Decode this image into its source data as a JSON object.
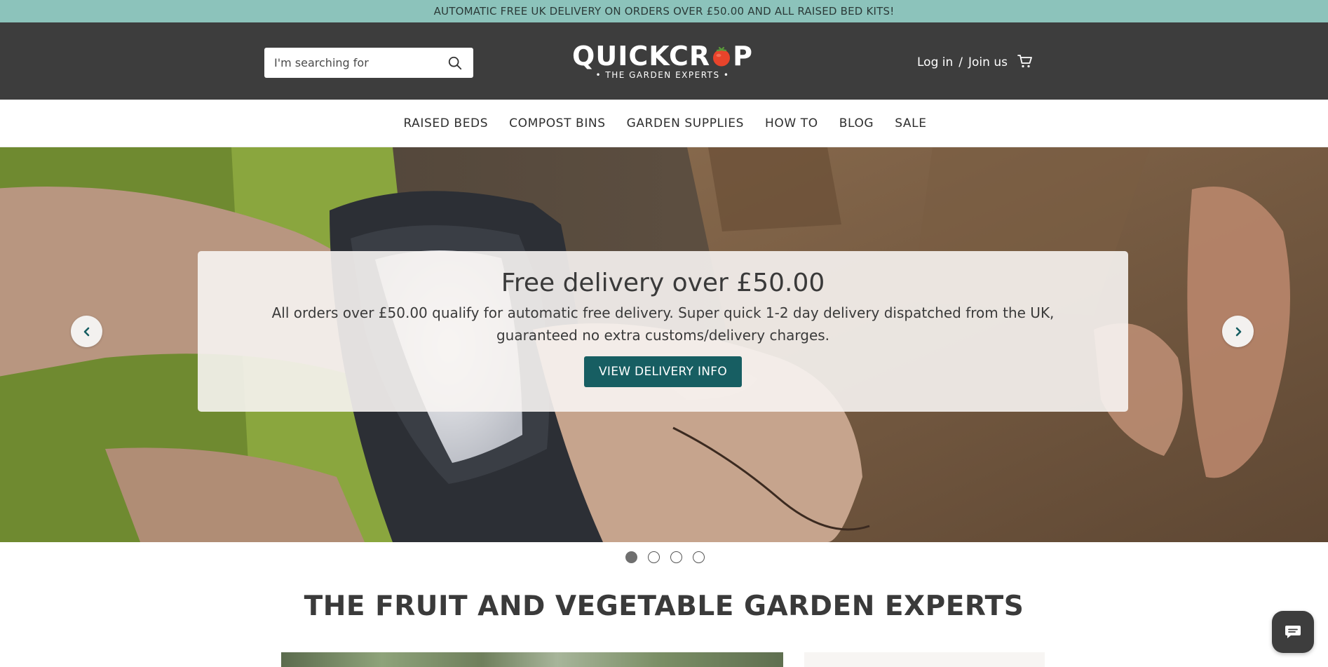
{
  "announcement": {
    "text": "AUTOMATIC FREE UK DELIVERY ON ORDERS OVER £50.00 AND ALL RAISED BED KITS!"
  },
  "header": {
    "search": {
      "placeholder": "I'm searching for"
    },
    "logo": {
      "word_left": "QUICKCR",
      "word_right": "P",
      "tagline": "• THE GARDEN EXPERTS •"
    },
    "account": {
      "login": "Log in",
      "separator": "/",
      "join": "Join us"
    }
  },
  "nav": {
    "items": [
      {
        "label": "RAISED BEDS"
      },
      {
        "label": "COMPOST BINS"
      },
      {
        "label": "GARDEN SUPPLIES"
      },
      {
        "label": "HOW TO"
      },
      {
        "label": "BLOG"
      },
      {
        "label": "SALE"
      }
    ]
  },
  "hero": {
    "title": "Free delivery over £50.00",
    "text": "All orders over £50.00 qualify for automatic free delivery. Super quick 1-2 day delivery dispatched from the UK, guaranteed no extra customs/delivery charges.",
    "button": "VIEW DELIVERY INFO",
    "slide_count": 4,
    "active_slide": 1
  },
  "section": {
    "title": "THE FRUIT AND VEGETABLE GARDEN EXPERTS"
  },
  "colors": {
    "announce_bg": "#8cc3bb",
    "header_bg": "#3d3d3d",
    "button_bg": "#175e62",
    "tomato": "#e8442b"
  },
  "icons": [
    "search-icon",
    "cart-icon",
    "chevron-left-icon",
    "chevron-right-icon",
    "chat-icon",
    "tomato-icon"
  ]
}
